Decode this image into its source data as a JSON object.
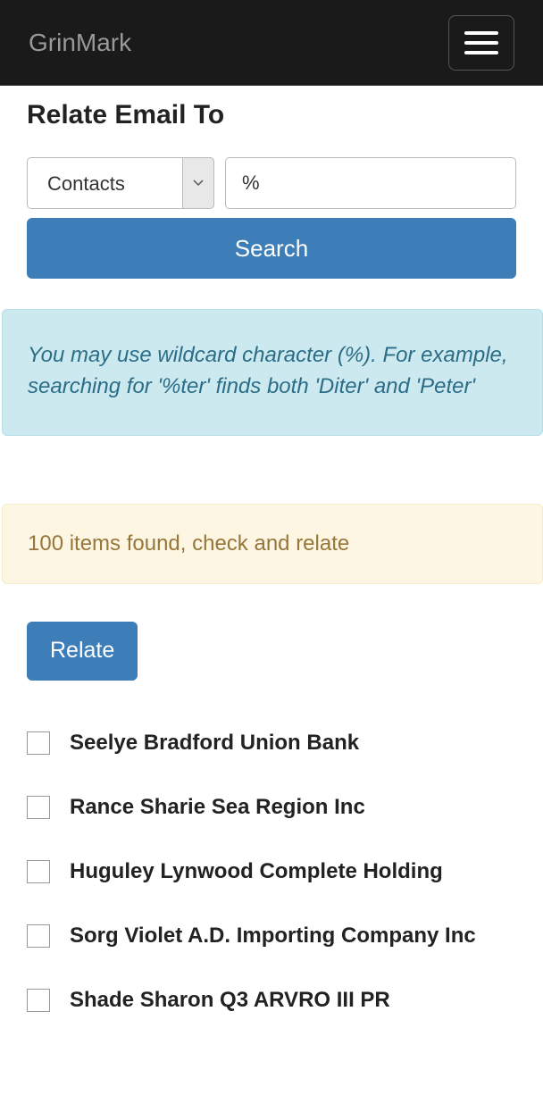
{
  "brand": "GrinMark",
  "page_title": "Relate Email To",
  "search": {
    "type_selected": "Contacts",
    "query_value": "%",
    "button_label": "Search"
  },
  "hint": "You may use wildcard character (%). For example, searching for '%ter' finds both 'Diter' and 'Peter'",
  "status": "100 items found, check and relate",
  "relate_button_label": "Relate",
  "results": [
    {
      "label": "Seelye Bradford Union Bank"
    },
    {
      "label": "Rance Sharie Sea Region Inc"
    },
    {
      "label": "Huguley Lynwood Complete Holding"
    },
    {
      "label": "Sorg Violet A.D. Importing Company Inc"
    },
    {
      "label": "Shade Sharon Q3 ARVRO III PR"
    }
  ]
}
